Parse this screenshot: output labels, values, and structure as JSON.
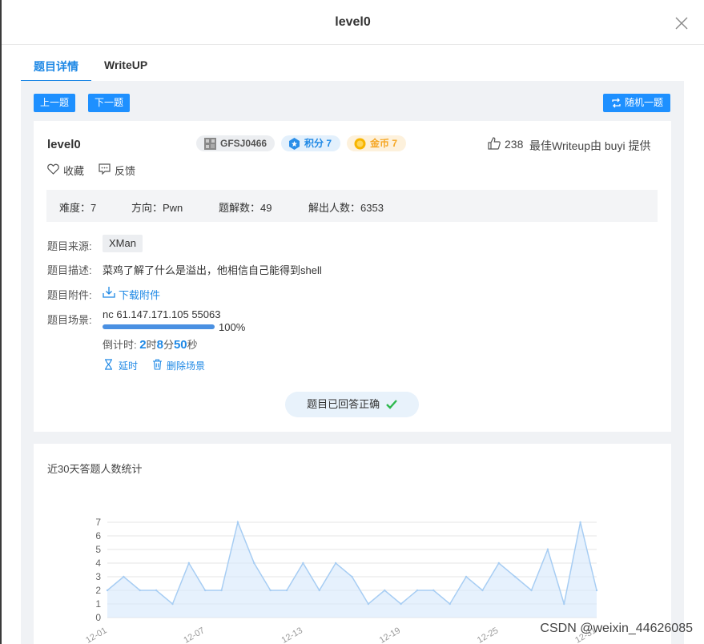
{
  "modal": {
    "title": "level0"
  },
  "tabs": [
    {
      "label": "题目详情",
      "active": true
    },
    {
      "label": "WriteUP",
      "active": false
    }
  ],
  "toolbar": {
    "prev": "上一题",
    "next": "下一题",
    "random": "随机一题"
  },
  "challenge": {
    "name": "level0",
    "id_badge": "GFSJ0466",
    "score_badge": "积分 7",
    "coin_badge": "金币 7",
    "likes": "238",
    "best_writeup": "最佳Writeup由 buyi 提供",
    "favorite": "收藏",
    "feedback": "反馈"
  },
  "stats": {
    "difficulty": "难度：7",
    "direction": "方向：Pwn",
    "solves_label": "题解数：49",
    "solvers": "解出人数：6353"
  },
  "details": {
    "source_label": "题目来源:",
    "source_value": "XMan",
    "desc_label": "题目描述:",
    "desc_value": "菜鸡了解了什么是溢出，他相信自己能得到shell",
    "attach_label": "题目附件:",
    "attach_value": "下载附件",
    "scene_label": "题目场景:",
    "scene_value": "nc 61.147.171.105 55063",
    "progress": 1.0,
    "progress_text": "100%",
    "countdown_prefix": "倒计时: ",
    "cd_h": "2",
    "cd_h_unit": "时",
    "cd_m": "8",
    "cd_m_unit": "分",
    "cd_s": "50",
    "cd_s_unit": "秒",
    "extend": "延时",
    "delete": "删除场景",
    "solved": "题目已回答正确"
  },
  "colors": {
    "accent": "#1e88e5",
    "button": "#1e90ff",
    "coin": "#f5a623",
    "success": "#2db84d"
  },
  "chart_data": {
    "type": "area",
    "title": "近30天答题人数统计",
    "x": [
      "12-01",
      "12-02",
      "12-03",
      "12-04",
      "12-05",
      "12-06",
      "12-07",
      "12-08",
      "12-09",
      "12-10",
      "12-11",
      "12-12",
      "12-13",
      "12-14",
      "12-15",
      "12-16",
      "12-17",
      "12-18",
      "12-19",
      "12-20",
      "12-21",
      "12-22",
      "12-23",
      "12-24",
      "12-25",
      "12-26",
      "12-27",
      "12-28",
      "12-29",
      "12-30",
      "12-31"
    ],
    "values": [
      2,
      3,
      2,
      2,
      1,
      4,
      2,
      2,
      7,
      4,
      2,
      2,
      4,
      2,
      4,
      3,
      1,
      2,
      1,
      2,
      2,
      1,
      3,
      2,
      4,
      3,
      2,
      5,
      1,
      7,
      2
    ],
    "x_tick_labels": [
      "12-01",
      "12-07",
      "12-13",
      "12-19",
      "12-25",
      "12-31"
    ],
    "y_ticks": [
      0,
      1,
      2,
      3,
      4,
      5,
      6,
      7
    ],
    "ylim": [
      0,
      7
    ],
    "grid": true
  },
  "watermark": "CSDN @weixin_44626085"
}
